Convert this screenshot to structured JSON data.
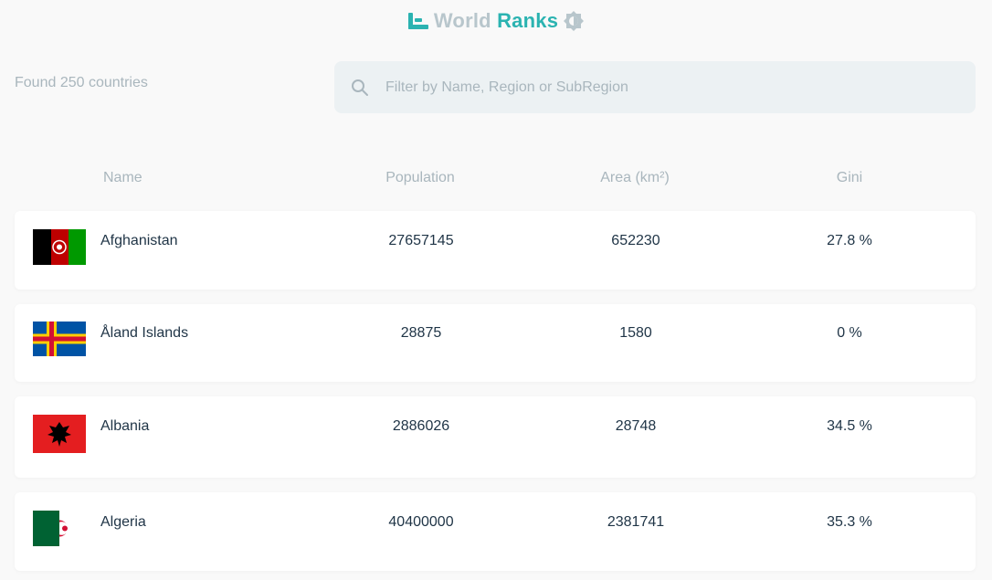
{
  "header": {
    "title_part1": "World",
    "title_part2": "Ranks",
    "logo_icon": "bar-rank-icon",
    "toggle_icon": "theme-toggle-icon"
  },
  "summary": {
    "count_text": "Found 250 countries"
  },
  "search": {
    "placeholder": "Filter by Name, Region or SubRegion",
    "value": "",
    "icon": "search-icon"
  },
  "table": {
    "headers": {
      "name": "Name",
      "population": "Population",
      "area": "Area (km²)",
      "gini": "Gini"
    },
    "rows": [
      {
        "name": "Afghanistan",
        "population": "27657145",
        "area": "652230",
        "gini": "27.8 %",
        "flag": "afghanistan-flag"
      },
      {
        "name": "Åland Islands",
        "population": "28875",
        "area": "1580",
        "gini": "0 %",
        "flag": "aland-islands-flag"
      },
      {
        "name": "Albania",
        "population": "2886026",
        "area": "28748",
        "gini": "34.5 %",
        "flag": "albania-flag"
      },
      {
        "name": "Algeria",
        "population": "40400000",
        "area": "2381741",
        "gini": "35.3 %",
        "flag": "algeria-flag"
      }
    ]
  },
  "colors": {
    "accent": "#2bb3b1",
    "muted": "#a9b6bd",
    "text": "#1f3446",
    "background": "#f9f9f9",
    "search_bg": "#ecf1f3"
  }
}
